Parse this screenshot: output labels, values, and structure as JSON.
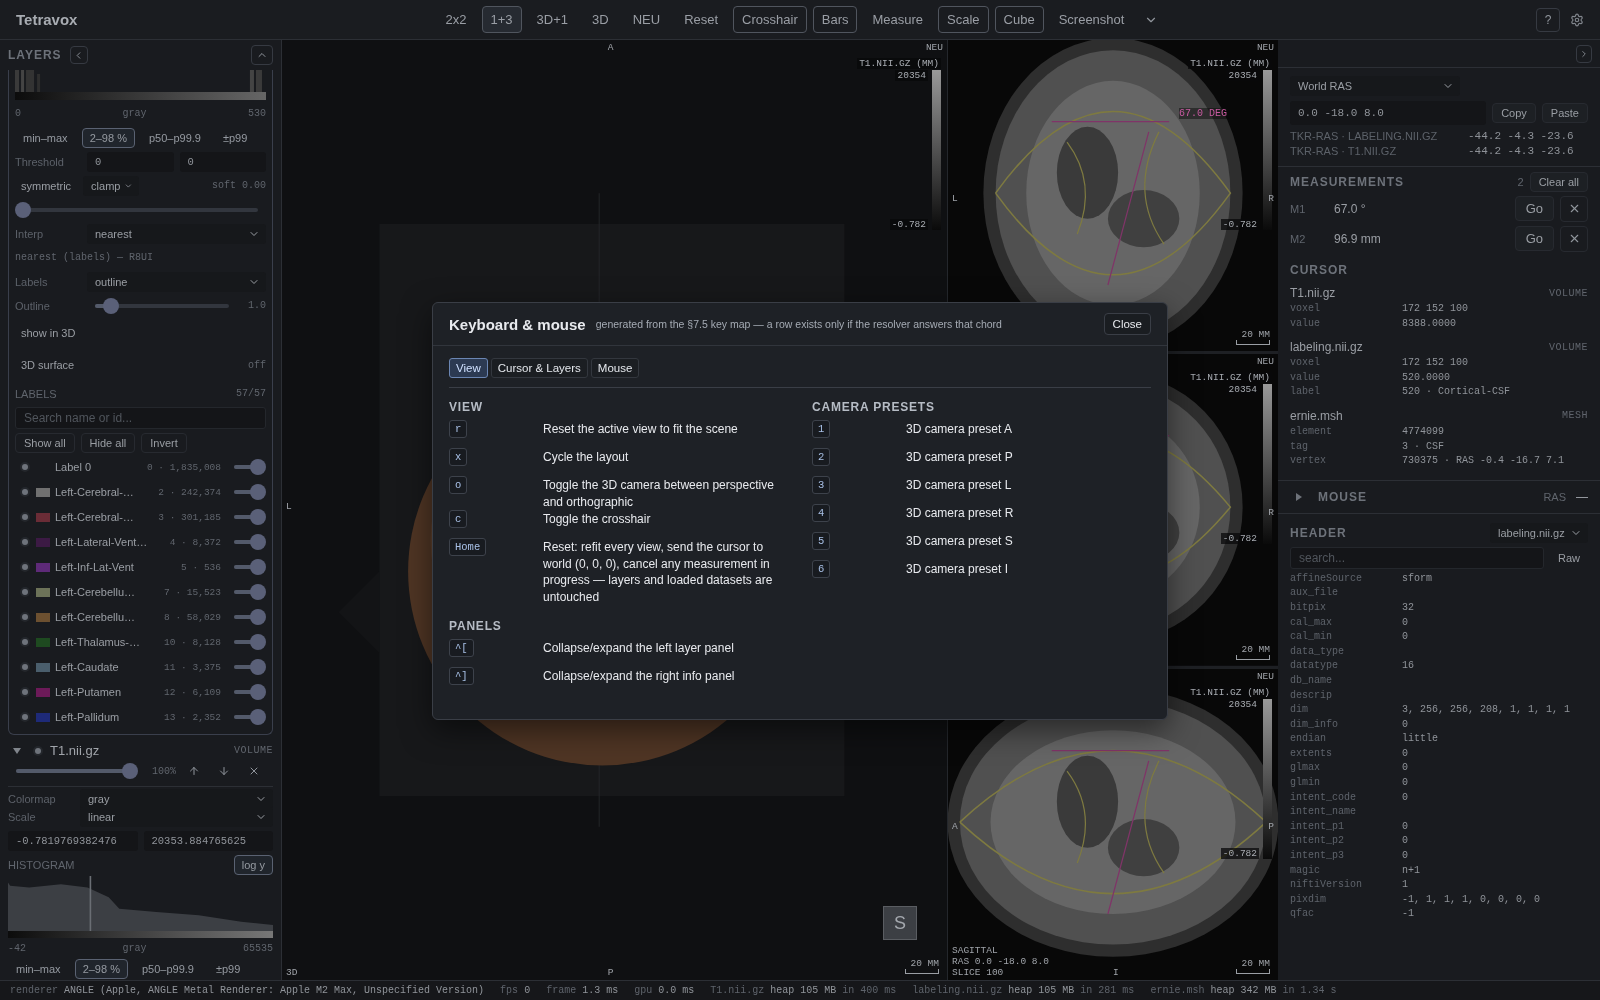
{
  "app": {
    "title": "Tetravox"
  },
  "toolbar": [
    {
      "label": "2x2",
      "kind": "layout",
      "selected": false
    },
    {
      "label": "1+3",
      "kind": "layout",
      "selected": true
    },
    {
      "label": "3D+1",
      "kind": "layout",
      "selected": false
    },
    {
      "label": "3D",
      "kind": "layout",
      "selected": false
    },
    {
      "label": "NEU",
      "kind": "layout",
      "selected": false
    },
    {
      "label": "Reset",
      "kind": "action"
    },
    {
      "label": "Crosshair",
      "kind": "toggle",
      "on": true
    },
    {
      "label": "Bars",
      "kind": "toggle",
      "on": true
    },
    {
      "label": "Measure",
      "kind": "toggle",
      "on": false
    },
    {
      "label": "Scale",
      "kind": "toggle",
      "on": true
    },
    {
      "label": "Cube",
      "kind": "toggle",
      "on": true
    },
    {
      "label": "Screenshot",
      "kind": "action"
    }
  ],
  "help_button": "?",
  "layers_panel": {
    "title": "LAYERS"
  },
  "labeling_layer": {
    "range": {
      "min": "0",
      "colormap": "gray",
      "max": "530"
    },
    "presets": [
      {
        "label": "min–max",
        "selected": false
      },
      {
        "label": "2–98 %",
        "selected": true
      },
      {
        "label": "p50–p99.9",
        "selected": false
      },
      {
        "label": "±p99",
        "selected": false
      }
    ],
    "threshold": {
      "label": "Threshold",
      "low": "0",
      "high": "0"
    },
    "symmetric": "symmetric",
    "clamp": "clamp",
    "soft": {
      "reading": "soft 0.00",
      "level": 0
    },
    "interp": {
      "label": "Interp",
      "value": "nearest"
    },
    "interp_note": "nearest (labels) — R8UI",
    "labels_mode": {
      "label": "Labels",
      "value": "outline"
    },
    "outline": {
      "label": "Outline",
      "level": 0.12,
      "reading": "1.0"
    },
    "show_in_3d": "show in 3D",
    "surface": {
      "label": "3D surface",
      "value": "off"
    },
    "labels": {
      "title": "LABELS",
      "count": "57/57",
      "search_placeholder": "Search name or id...",
      "actions": [
        "Show all",
        "Hide all",
        "Invert"
      ],
      "items": [
        {
          "name": "Label 0",
          "stats": "0 · 1,835,008",
          "level": 1
        },
        {
          "name": "Left-Cerebral-…",
          "stats": "2 · 242,374",
          "color": "#707070",
          "level": 1
        },
        {
          "name": "Left-Cerebral-…",
          "stats": "3 · 301,185",
          "color": "#6a2c36",
          "level": 1
        },
        {
          "name": "Left-Lateral-Vent…",
          "stats": "4 · 8,372",
          "color": "#3c1a44",
          "level": 1
        },
        {
          "name": "Left-Inf-Lat-Vent",
          "stats": "5 · 536",
          "color": "#5e2a78",
          "level": 1
        },
        {
          "name": "Left-Cerebellu…",
          "stats": "7 · 15,523",
          "color": "#6c7258",
          "level": 1
        },
        {
          "name": "Left-Cerebellu…",
          "stats": "8 · 58,029",
          "color": "#6c5030",
          "level": 1
        },
        {
          "name": "Left-Thalamus-…",
          "stats": "10 · 8,128",
          "color": "#1e4a20",
          "level": 1
        },
        {
          "name": "Left-Caudate",
          "stats": "11 · 3,375",
          "color": "#4a5e6c",
          "level": 1
        },
        {
          "name": "Left-Putamen",
          "stats": "12 · 6,109",
          "color": "#6c1a58",
          "level": 1
        },
        {
          "name": "Left-Pallidum",
          "stats": "13 · 2,352",
          "color": "#1e2a78",
          "level": 1
        }
      ]
    }
  },
  "t1_layer": {
    "name": "T1.nii.gz",
    "type": "VOLUME",
    "opacity": {
      "level": 1,
      "reading": "100%"
    },
    "colormap": {
      "label": "Colormap",
      "value": "gray"
    },
    "scale": {
      "label": "Scale",
      "value": "linear"
    },
    "min": "-0.7819769382476",
    "max": "20353.884765625",
    "histogram": {
      "title": "HISTOGRAM",
      "log_button": "log y",
      "min": "-42",
      "colormap": "gray",
      "max": "65535"
    },
    "presets": [
      {
        "label": "min–max",
        "selected": false
      },
      {
        "label": "2–98 %",
        "selected": true
      },
      {
        "label": "p50–p99.9",
        "selected": false
      },
      {
        "label": "±p99",
        "selected": false
      }
    ]
  },
  "main_view": {
    "top": "A",
    "left": "L",
    "bottom": "P",
    "corner": "3D",
    "orientation": "NEU",
    "colorbar": {
      "title": "T1.NII.GZ (MM)",
      "max": "20354",
      "min": "-0.782"
    },
    "scale": "20 MM",
    "cube_button": "S"
  },
  "slice_views": [
    {
      "kind": "axial",
      "orientation": "NEU",
      "colorbar": {
        "title": "T1.NII.GZ (MM)",
        "max": "20354",
        "min": "-0.782"
      },
      "left": "L",
      "right": "R",
      "annotation": "67.0 DEG",
      "scale": "20 MM"
    },
    {
      "kind": "coronal",
      "orientation": "NEU",
      "colorbar": {
        "title": "T1.NII.GZ (MM)",
        "max": "20354",
        "min": "-0.782"
      },
      "right": "R",
      "scale": "20 MM"
    },
    {
      "kind": "sagittal",
      "orientation": "NEU",
      "colorbar": {
        "title": "T1.NII.GZ (MM)",
        "max": "20354",
        "min": "-0.782"
      },
      "left": "A",
      "right": "P",
      "bottom": "I",
      "info": [
        "SAGITTAL",
        "RAS 0.0 -18.0 8.0",
        "SLICE 100"
      ],
      "scale": "20 MM"
    }
  ],
  "coordinates": {
    "space": "World RAS",
    "value": "0.0 -18.0 8.0",
    "copy": "Copy",
    "paste": "Paste",
    "tkr": [
      {
        "label": "TKR-RAS · LABELING.NII.GZ",
        "value": "-44.2 -4.3 -23.6"
      },
      {
        "label": "TKR-RAS · T1.NII.GZ",
        "value": "-44.2 -4.3 -23.6"
      }
    ]
  },
  "measurements": {
    "title": "MEASUREMENTS",
    "count": "2",
    "clear": "Clear all",
    "items": [
      {
        "id": "M1",
        "value": "67.0 °",
        "go": "Go"
      },
      {
        "id": "M2",
        "value": "96.9 mm",
        "go": "Go"
      }
    ]
  },
  "cursor": {
    "title": "CURSOR",
    "layers": [
      {
        "name": "T1.nii.gz",
        "type": "VOLUME",
        "fields": [
          {
            "key": "voxel",
            "value": "172 152 100"
          },
          {
            "key": "value",
            "value": "8388.0000"
          }
        ]
      },
      {
        "name": "labeling.nii.gz",
        "type": "VOLUME",
        "fields": [
          {
            "key": "voxel",
            "value": "172 152 100"
          },
          {
            "key": "value",
            "value": "520.0000"
          },
          {
            "key": "label",
            "value": "520 · Cortical-CSF"
          }
        ]
      },
      {
        "name": "ernie.msh",
        "type": "MESH",
        "fields": [
          {
            "key": "element",
            "value": "4774099"
          },
          {
            "key": "tag",
            "value": "3 · CSF"
          },
          {
            "key": "vertex",
            "value": "730375 · RAS -0.4 -16.7 7.1"
          }
        ]
      }
    ]
  },
  "mouse": {
    "title": "MOUSE",
    "space": "RAS",
    "value": "—",
    "expanded": false
  },
  "header": {
    "title": "HEADER",
    "file": "labeling.nii.gz",
    "search_placeholder": "search...",
    "raw": "Raw",
    "fields": [
      {
        "key": "affineSource",
        "value": "sform"
      },
      {
        "key": "aux_file"
      },
      {
        "key": "bitpix",
        "value": "32"
      },
      {
        "key": "cal_max",
        "value": "0"
      },
      {
        "key": "cal_min",
        "value": "0"
      },
      {
        "key": "data_type"
      },
      {
        "key": "datatype",
        "value": "16"
      },
      {
        "key": "db_name"
      },
      {
        "key": "descrip"
      },
      {
        "key": "dim",
        "value": "3, 256, 256, 208, 1, 1, 1, 1"
      },
      {
        "key": "dim_info",
        "value": "0"
      },
      {
        "key": "endian",
        "value": "little"
      },
      {
        "key": "extents",
        "value": "0"
      },
      {
        "key": "glmax",
        "value": "0"
      },
      {
        "key": "glmin",
        "value": "0"
      },
      {
        "key": "intent_code",
        "value": "0"
      },
      {
        "key": "intent_name"
      },
      {
        "key": "intent_p1",
        "value": "0"
      },
      {
        "key": "intent_p2",
        "value": "0"
      },
      {
        "key": "intent_p3",
        "value": "0"
      },
      {
        "key": "magic",
        "value": "n+1"
      },
      {
        "key": "niftiVersion",
        "value": "1"
      },
      {
        "key": "pixdim",
        "value": "-1, 1, 1, 1, 0, 0, 0, 0"
      },
      {
        "key": "qfac",
        "value": "-1"
      }
    ]
  },
  "status_bar": [
    {
      "key": "renderer",
      "value": "ANGLE (Apple, ANGLE Metal Renderer: Apple M2 Max, Unspecified Version)"
    },
    {
      "key": "fps",
      "value": "0"
    },
    {
      "key": "frame",
      "value": "1.3 ms"
    },
    {
      "key": "gpu",
      "value": "0.0 ms"
    },
    {
      "key": "T1.nii.gz",
      "value": "heap 105 MB",
      "extra": "in 400 ms"
    },
    {
      "key": "labeling.nii.gz",
      "value": "heap 105 MB",
      "extra": "in 281 ms"
    },
    {
      "key": "ernie.msh",
      "value": "heap 342 MB",
      "extra": "in 1.34 s"
    }
  ],
  "dialog": {
    "title": "Keyboard & mouse",
    "subtitle": "generated from the §7.5 key map — a row exists only if the resolver answers that chord",
    "close": "Close",
    "tabs": [
      {
        "label": "View",
        "selected": true
      },
      {
        "label": "Cursor & Layers",
        "selected": false
      },
      {
        "label": "Mouse",
        "selected": false
      }
    ],
    "columns": [
      [
        {
          "title": "VIEW",
          "rows": [
            {
              "key": "r",
              "action": "Reset the active view to fit the scene"
            },
            {
              "key": "x",
              "action": "Cycle the layout"
            },
            {
              "key": "o",
              "action": "Toggle the 3D camera between perspective and orthographic"
            },
            {
              "key": "c",
              "action": "Toggle the crosshair"
            },
            {
              "key": "Home",
              "action": "Reset: refit every view, send the cursor to world (0, 0, 0), cancel any measurement in progress — layers and loaded datasets are untouched"
            }
          ]
        },
        {
          "title": "PANELS",
          "rows": [
            {
              "key": "^[",
              "action": "Collapse/expand the left layer panel"
            },
            {
              "key": "^]",
              "action": "Collapse/expand the right info panel"
            }
          ]
        }
      ],
      [
        {
          "title": "CAMERA PRESETS",
          "rows": [
            {
              "key": "1",
              "action": "3D camera preset A"
            },
            {
              "key": "2",
              "action": "3D camera preset P"
            },
            {
              "key": "3",
              "action": "3D camera preset L"
            },
            {
              "key": "4",
              "action": "3D camera preset R"
            },
            {
              "key": "5",
              "action": "3D camera preset S"
            },
            {
              "key": "6",
              "action": "3D camera preset I"
            }
          ]
        }
      ]
    ]
  }
}
